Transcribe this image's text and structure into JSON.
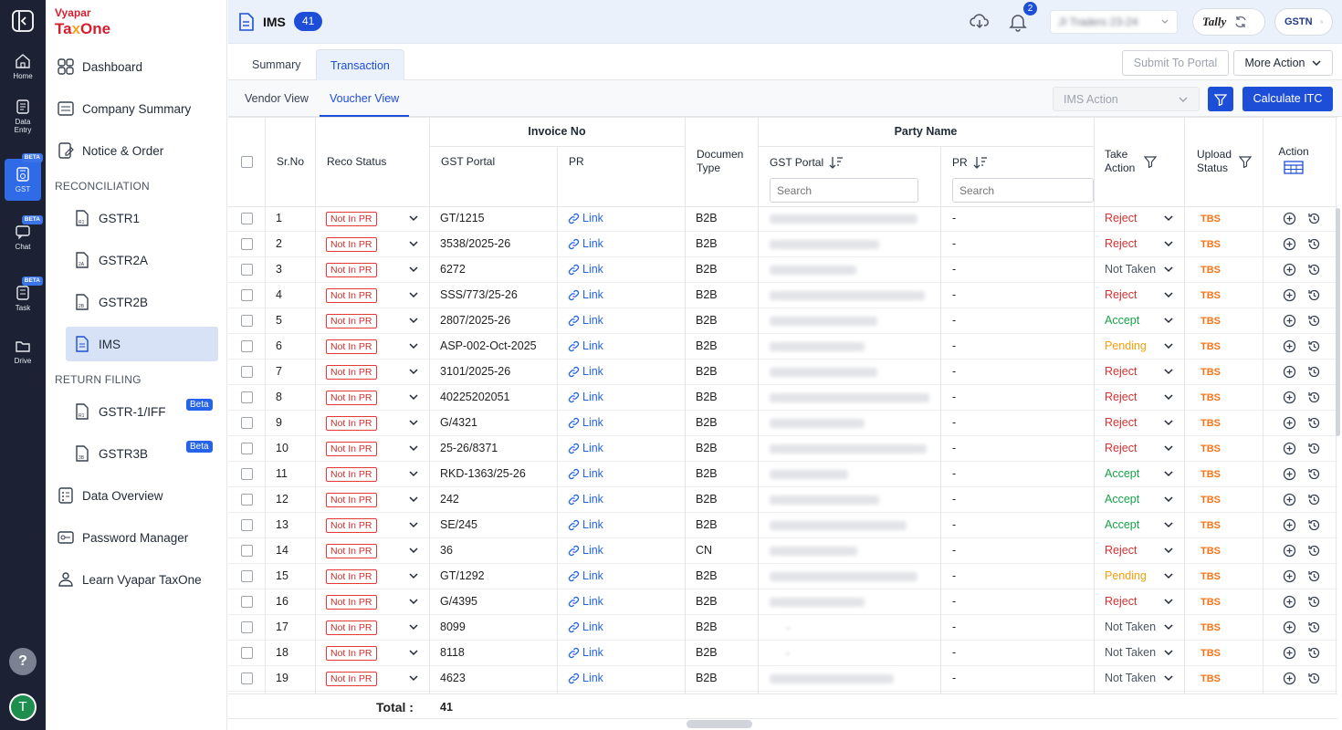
{
  "brand": {
    "line1": "Vyapar",
    "line2_a": "Ta",
    "line2_b": "x",
    "line2_c": "One"
  },
  "rail": {
    "home": "Home",
    "data_entry_1": "Data",
    "data_entry_2": "Entry",
    "gst": "GST",
    "chat": "Chat",
    "task": "Task",
    "drive": "Drive",
    "beta": "BETA",
    "help": "?",
    "avatar": "T"
  },
  "sidebar": {
    "dashboard": "Dashboard",
    "company_summary": "Company Summary",
    "notice_order": "Notice & Order",
    "sec_reco": "RECONCILIATION",
    "gstr1": "GSTR1",
    "gstr2a": "GSTR2A",
    "gstr2b": "GSTR2B",
    "ims": "IMS",
    "sec_return": "RETURN FILING",
    "gstr1iff": "GSTR-1/IFF",
    "gstr3b": "GSTR3B",
    "beta": "Beta",
    "data_overview": "Data Overview",
    "password_manager": "Password Manager",
    "learn": "Learn Vyapar TaxOne"
  },
  "header": {
    "title": "IMS",
    "count": "41",
    "notif_count": "2",
    "company": "JI Traders 23-24",
    "tally": "Tally",
    "gstn": "GSTN"
  },
  "tabs": {
    "summary": "Summary",
    "transaction": "Transaction"
  },
  "actions": {
    "submit": "Submit To Portal",
    "more": "More Action",
    "ims_action": "IMS Action",
    "calculate": "Calculate ITC"
  },
  "views": {
    "vendor": "Vendor View",
    "voucher": "Voucher View"
  },
  "columns": {
    "srno": "Sr.No",
    "reco_status": "Reco Status",
    "invoice_no": "Invoice No",
    "gst_portal": "GST Portal",
    "pr": "PR",
    "doc_type_1": "Documen",
    "doc_type_2": "Type",
    "party_name": "Party Name",
    "take_action_1": "Take",
    "take_action_2": "Action",
    "upload_status_1": "Upload",
    "upload_status_2": "Status",
    "action": "Action",
    "search_placeholder": "Search"
  },
  "rows": [
    {
      "sr": "1",
      "status": "Not In PR",
      "inv": "GT/1215",
      "pr": "Link",
      "doc": "B2B",
      "party": "SHREE SHAKTI TRADING CO",
      "pp": "-",
      "take": "Reject",
      "upload": "TBS"
    },
    {
      "sr": "2",
      "status": "Not In PR",
      "inv": "3538/2025-26",
      "pr": "Link",
      "doc": "B2B",
      "party": "KOMAL TRADING CO",
      "pp": "-",
      "take": "Reject",
      "upload": "TBS"
    },
    {
      "sr": "3",
      "status": "Not In PR",
      "inv": "6272",
      "pr": "Link",
      "doc": "B2B",
      "party": "SHYAM AGENCY",
      "pp": "-",
      "take": "Not Taken",
      "upload": "TBS"
    },
    {
      "sr": "4",
      "status": "Not In PR",
      "inv": "SSS/773/25-26",
      "pr": "Link",
      "doc": "B2B",
      "party": "SHREE SHANKESHWAR SPICE",
      "pp": "-",
      "take": "Reject",
      "upload": "TBS"
    },
    {
      "sr": "5",
      "status": "Not In PR",
      "inv": "2807/2025-26",
      "pr": "Link",
      "doc": "B2B",
      "party": "GANESH KIRANA CO",
      "pp": "-",
      "take": "Accept",
      "upload": "TBS"
    },
    {
      "sr": "6",
      "status": "Not In PR",
      "inv": "ASP-002-Oct-2025",
      "pr": "Link",
      "doc": "B2B",
      "party": "ANITA SPICES LLP",
      "pp": "-",
      "take": "Pending",
      "upload": "TBS"
    },
    {
      "sr": "7",
      "status": "Not In PR",
      "inv": "3101/2025-26",
      "pr": "Link",
      "doc": "B2B",
      "party": "AKASH TRADING CO",
      "pp": "-",
      "take": "Reject",
      "upload": "TBS"
    },
    {
      "sr": "8",
      "status": "Not In PR",
      "inv": "40225202051",
      "pr": "Link",
      "doc": "B2B",
      "party": "OM LOGISTICS SUPPLY CHAIN",
      "pp": "-",
      "take": "Reject",
      "upload": "TBS"
    },
    {
      "sr": "9",
      "status": "Not In PR",
      "inv": "G/4321",
      "pr": "Link",
      "doc": "B2B",
      "party": "GAYATRI GENERAL",
      "pp": "-",
      "take": "Reject",
      "upload": "TBS"
    },
    {
      "sr": "10",
      "status": "Not In PR",
      "inv": "25-26/8371",
      "pr": "Link",
      "doc": "B2B",
      "party": "PATEL GHANSHYAMBHAI M",
      "pp": "-",
      "take": "Reject",
      "upload": "TBS"
    },
    {
      "sr": "11",
      "status": "Not In PR",
      "inv": "RKD-1363/25-26",
      "pr": "Link",
      "doc": "B2B",
      "party": "R K DRYFRUITS",
      "pp": "-",
      "take": "Accept",
      "upload": "TBS"
    },
    {
      "sr": "12",
      "status": "Not In PR",
      "inv": "242",
      "pr": "Link",
      "doc": "B2B",
      "party": "SHREE GANESH TRADERS",
      "pp": "-",
      "take": "Accept",
      "upload": "TBS"
    },
    {
      "sr": "13",
      "status": "Not In PR",
      "inv": "SE/245",
      "pr": "Link",
      "doc": "B2B",
      "party": "SACCHA SAUDA TRADERS",
      "pp": "-",
      "take": "Accept",
      "upload": "TBS"
    },
    {
      "sr": "14",
      "status": "Not In PR",
      "inv": "36",
      "pr": "Link",
      "doc": "CN",
      "party": "VIMAL TRADERS",
      "pp": "-",
      "take": "Reject",
      "upload": "TBS"
    },
    {
      "sr": "15",
      "status": "Not In PR",
      "inv": "GT/1292",
      "pr": "Link",
      "doc": "B2B",
      "party": "SHREE SHAKTI TRADING CO",
      "pp": "-",
      "take": "Pending",
      "upload": "TBS"
    },
    {
      "sr": "16",
      "status": "Not In PR",
      "inv": "G/4395",
      "pr": "Link",
      "doc": "B2B",
      "party": "GAYATRI GENERAL",
      "pp": "-",
      "take": "Reject",
      "upload": "TBS"
    },
    {
      "sr": "17",
      "status": "Not In PR",
      "inv": "8099",
      "pr": "Link",
      "doc": "B2B",
      "party": "-",
      "pp": "-",
      "take": "Not Taken",
      "upload": "TBS"
    },
    {
      "sr": "18",
      "status": "Not In PR",
      "inv": "8118",
      "pr": "Link",
      "doc": "B2B",
      "party": "-",
      "pp": "-",
      "take": "Not Taken",
      "upload": "TBS"
    },
    {
      "sr": "19",
      "status": "Not In PR",
      "inv": "4623",
      "pr": "Link",
      "doc": "B2B",
      "party": "SIPAH KIRYANA STORES",
      "pp": "-",
      "take": "Not Taken",
      "upload": "TBS"
    }
  ],
  "total": {
    "label": "Total :",
    "value": "41"
  },
  "colors": {
    "accent": "#1d4ed8",
    "reject": "#d32f2f",
    "accept": "#16a34a",
    "pending": "#f59e0b",
    "not_taken": "#4b5563",
    "tbs": "#f97316",
    "rail": "#1c2233"
  }
}
